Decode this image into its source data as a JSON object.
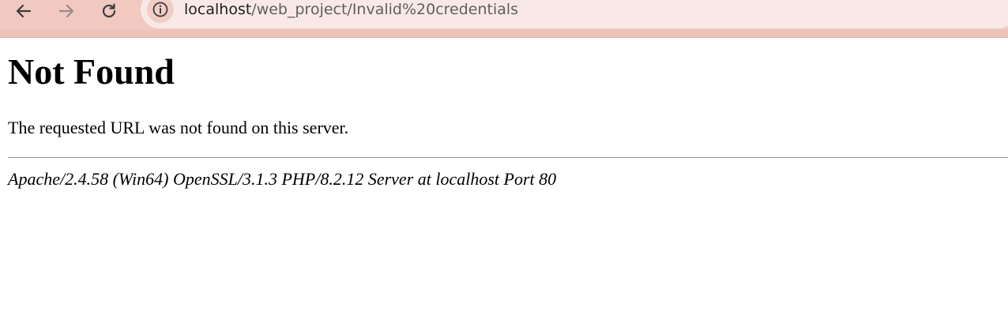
{
  "browser": {
    "url_host": "localhost",
    "url_path": "/web_project/Invalid%20credentials",
    "icons": {
      "back": "arrow-left-icon",
      "forward": "arrow-right-icon",
      "reload": "reload-icon",
      "site_info": "info-icon"
    },
    "colors": {
      "toolbar": "#f1c9c1",
      "omnibox": "#f9e9e6"
    }
  },
  "page": {
    "heading": "Not Found",
    "message": "The requested URL was not found on this server.",
    "server_signature": "Apache/2.4.58 (Win64) OpenSSL/3.1.3 PHP/8.2.12 Server at localhost Port 80"
  }
}
